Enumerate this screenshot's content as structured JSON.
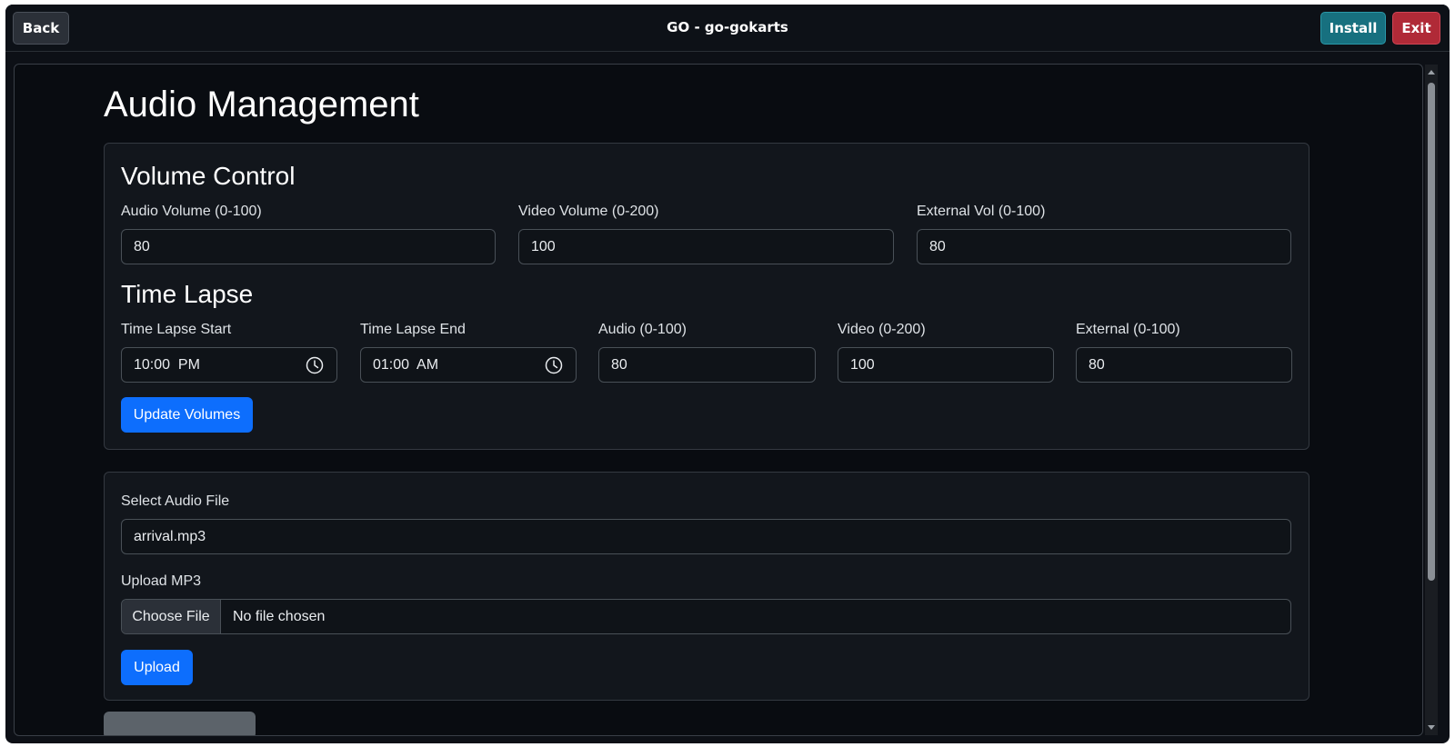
{
  "topbar": {
    "back_label": "Back",
    "title": "GO - go-gokarts",
    "install_label": "Install",
    "exit_label": "Exit"
  },
  "page": {
    "title": "Audio Management"
  },
  "volume_control": {
    "title": "Volume Control",
    "audio_volume": {
      "label": "Audio Volume (0-100)",
      "value": "80"
    },
    "video_volume": {
      "label": "Video Volume (0-200)",
      "value": "100"
    },
    "external_volume": {
      "label": "External Vol (0-100)",
      "value": "80"
    }
  },
  "time_lapse": {
    "title": "Time Lapse",
    "start": {
      "label": "Time Lapse Start",
      "value": "10:00  PM"
    },
    "end": {
      "label": "Time Lapse End",
      "value": "01:00  AM"
    },
    "audio": {
      "label": "Audio (0-100)",
      "value": "80"
    },
    "video": {
      "label": "Video (0-200)",
      "value": "100"
    },
    "external": {
      "label": "External (0-100)",
      "value": "80"
    },
    "update_label": "Update Volumes"
  },
  "audio_file": {
    "select_label": "Select Audio File",
    "selected_value": "arrival.mp3",
    "upload_label": "Upload MP3",
    "choose_file_label": "Choose File",
    "file_status": "No file chosen",
    "upload_button_label": "Upload"
  },
  "icons": {
    "clock": "clock-icon"
  },
  "colors": {
    "primary": "#0d6efd",
    "install": "#17707f",
    "exit": "#b02a37",
    "background": "#090c11"
  }
}
